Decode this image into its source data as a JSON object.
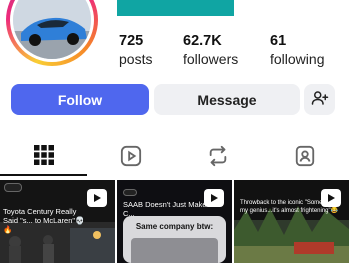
{
  "profile": {
    "stats": {
      "posts_count": "725",
      "posts_label": "posts",
      "followers_count": "62.7K",
      "followers_label": "followers",
      "following_count": "61",
      "following_label": "following"
    }
  },
  "actions": {
    "follow_label": "Follow",
    "message_label": "Message",
    "add_user_icon": "person-add-icon"
  },
  "tabs": [
    {
      "name": "posts",
      "icon": "grid-icon",
      "active": true
    },
    {
      "name": "reels",
      "icon": "reels-icon",
      "active": false
    },
    {
      "name": "reposts",
      "icon": "repost-icon",
      "active": false
    },
    {
      "name": "tagged",
      "icon": "tagged-icon",
      "active": false
    }
  ],
  "grid": [
    {
      "caption": "Toyota Century Really Said \"s... to McLaren\"💀🔥",
      "type": "reel"
    },
    {
      "caption": "SAAB Doesn't Just Make C...",
      "overlay": "Same company btw:",
      "type": "reel"
    },
    {
      "caption": "Throwback to the iconic \"Somethi... my genius...it's almost frightening\"😂",
      "type": "reel"
    }
  ],
  "colors": {
    "follow_button": "#4f67ee",
    "secondary_button": "#eff0f3",
    "banner": "#10a5a3"
  }
}
